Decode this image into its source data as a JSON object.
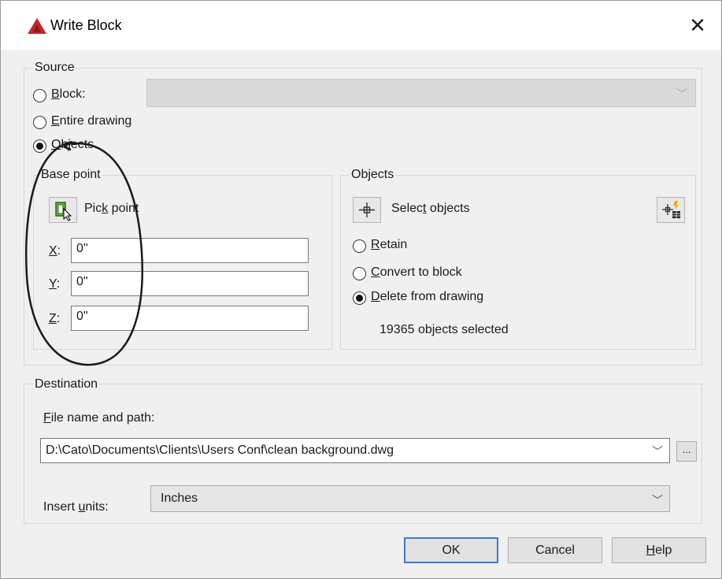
{
  "dialog": {
    "title": "Write Block",
    "close_label": "✕"
  },
  "source": {
    "legend": "Source",
    "block_label_prefix": "",
    "block_label_access": "B",
    "block_label_rest": "lock:",
    "entire_access": "E",
    "entire_rest": "ntire drawing",
    "objects_access": "O",
    "objects_rest": "bjects",
    "selected_option": "Objects"
  },
  "base_point": {
    "legend": "Base point",
    "pick_pre": "Pic",
    "pick_access": "k",
    "pick_post": " point",
    "x_access": "X",
    "x_rest": ":",
    "x_value": "0\"",
    "y_access": "Y",
    "y_rest": ":",
    "y_value": "0\"",
    "z_access": "Z",
    "z_rest": ":",
    "z_value": "0\""
  },
  "objects": {
    "legend": "Objects",
    "select_pre": "Selec",
    "select_access": "t",
    "select_post": " objects",
    "retain_access": "R",
    "retain_rest": "etain",
    "convert_access": "C",
    "convert_rest": "onvert to block",
    "delete_access": "D",
    "delete_rest": "elete from drawing",
    "selected_option": "Delete from drawing",
    "status": "19365 objects selected"
  },
  "destination": {
    "legend": "Destination",
    "file_access": "F",
    "file_rest": "ile name and path:",
    "file_value": "D:\\Cato\\Documents\\Clients\\Users Conf\\clean background.dwg",
    "browse_label": "...",
    "units_pre": "Insert ",
    "units_access": "u",
    "units_post": "nits:",
    "units_value": "Inches"
  },
  "buttons": {
    "ok": "OK",
    "cancel": "Cancel",
    "help_access": "H",
    "help_rest": "elp"
  },
  "colors": {
    "accent": "#c1272d",
    "annotation": "#1a1a1a",
    "default_button_border": "#3c78d8"
  }
}
